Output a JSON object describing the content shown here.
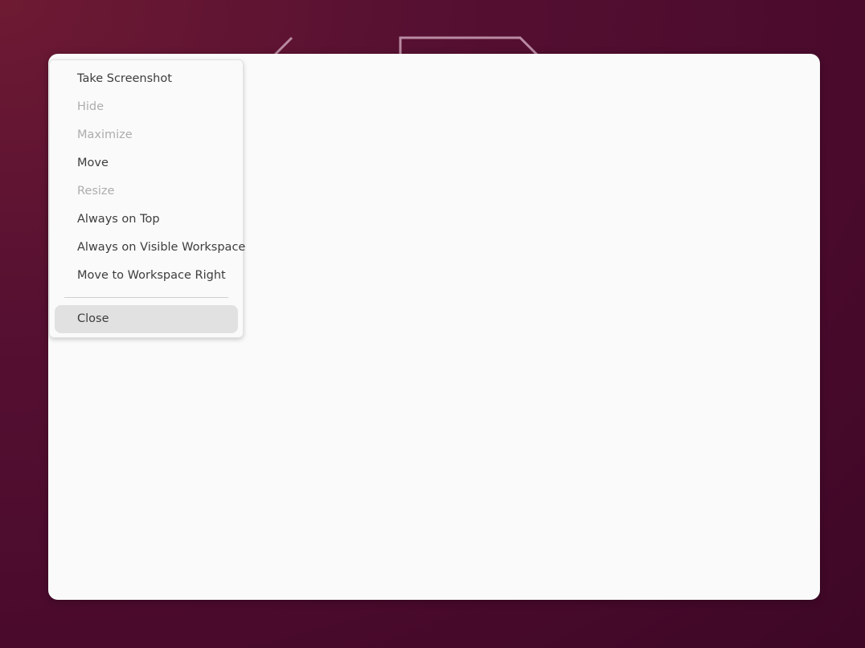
{
  "menu": {
    "items": [
      {
        "label": "Take Screenshot",
        "enabled": true
      },
      {
        "label": "Hide",
        "enabled": false
      },
      {
        "label": "Maximize",
        "enabled": false
      },
      {
        "label": "Move",
        "enabled": true
      },
      {
        "label": "Resize",
        "enabled": false
      },
      {
        "label": "Always on Top",
        "enabled": true
      },
      {
        "label": "Always on Visible Workspace",
        "enabled": true
      },
      {
        "label": "Move to Workspace Right",
        "enabled": true
      }
    ],
    "close": {
      "label": "Close",
      "enabled": true,
      "highlighted": true
    }
  },
  "colors": {
    "wallpaper": "#4a0a2c",
    "window_bg": "#fafafa",
    "menu_text": "#3d3d3d",
    "menu_text_disabled": "#adadad",
    "menu_hover": "#e1e1e1"
  }
}
